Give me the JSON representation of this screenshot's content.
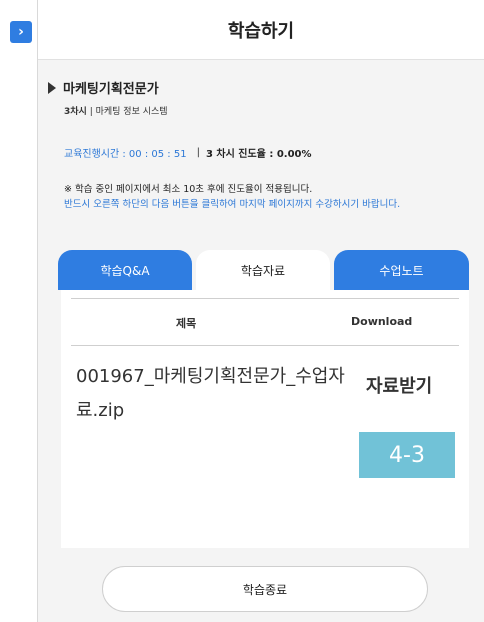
{
  "sidebar": {
    "toggle_glyph": "›"
  },
  "header": {
    "title": "학습하기"
  },
  "course": {
    "name": "마케팅기획전문가",
    "session": "3차시",
    "subtitle": "| 마케팅 정보 시스템"
  },
  "progress": {
    "time_label": "교육진행시간 : 00 : 05 : 51",
    "separator": "|",
    "rate_label": "3 차시 진도율 : 0.00%"
  },
  "notice": {
    "line1": "※ 학습 중인 페이지에서 최소 10초 후에 진도율이 적용됩니다.",
    "line2": "반드시 오른쪽 하단의 다음 버튼을 클릭하여 마지막 페이지까지 수강하시기 바랍니다."
  },
  "tabs": [
    {
      "label": "학습Q&A"
    },
    {
      "label": "학습자료"
    },
    {
      "label": "수업노트"
    }
  ],
  "materials": {
    "col_title": "제목",
    "col_download": "Download",
    "file_name": "001967_마케팅기획전문가_수업자료.zip",
    "download_label": "자료받기",
    "stamp_text": "4-3"
  },
  "footer": {
    "end_label": "학습종료"
  },
  "colors": {
    "accent": "#2f7de1",
    "stamp": "#71c2d7",
    "link_text": "#2d78d6"
  }
}
